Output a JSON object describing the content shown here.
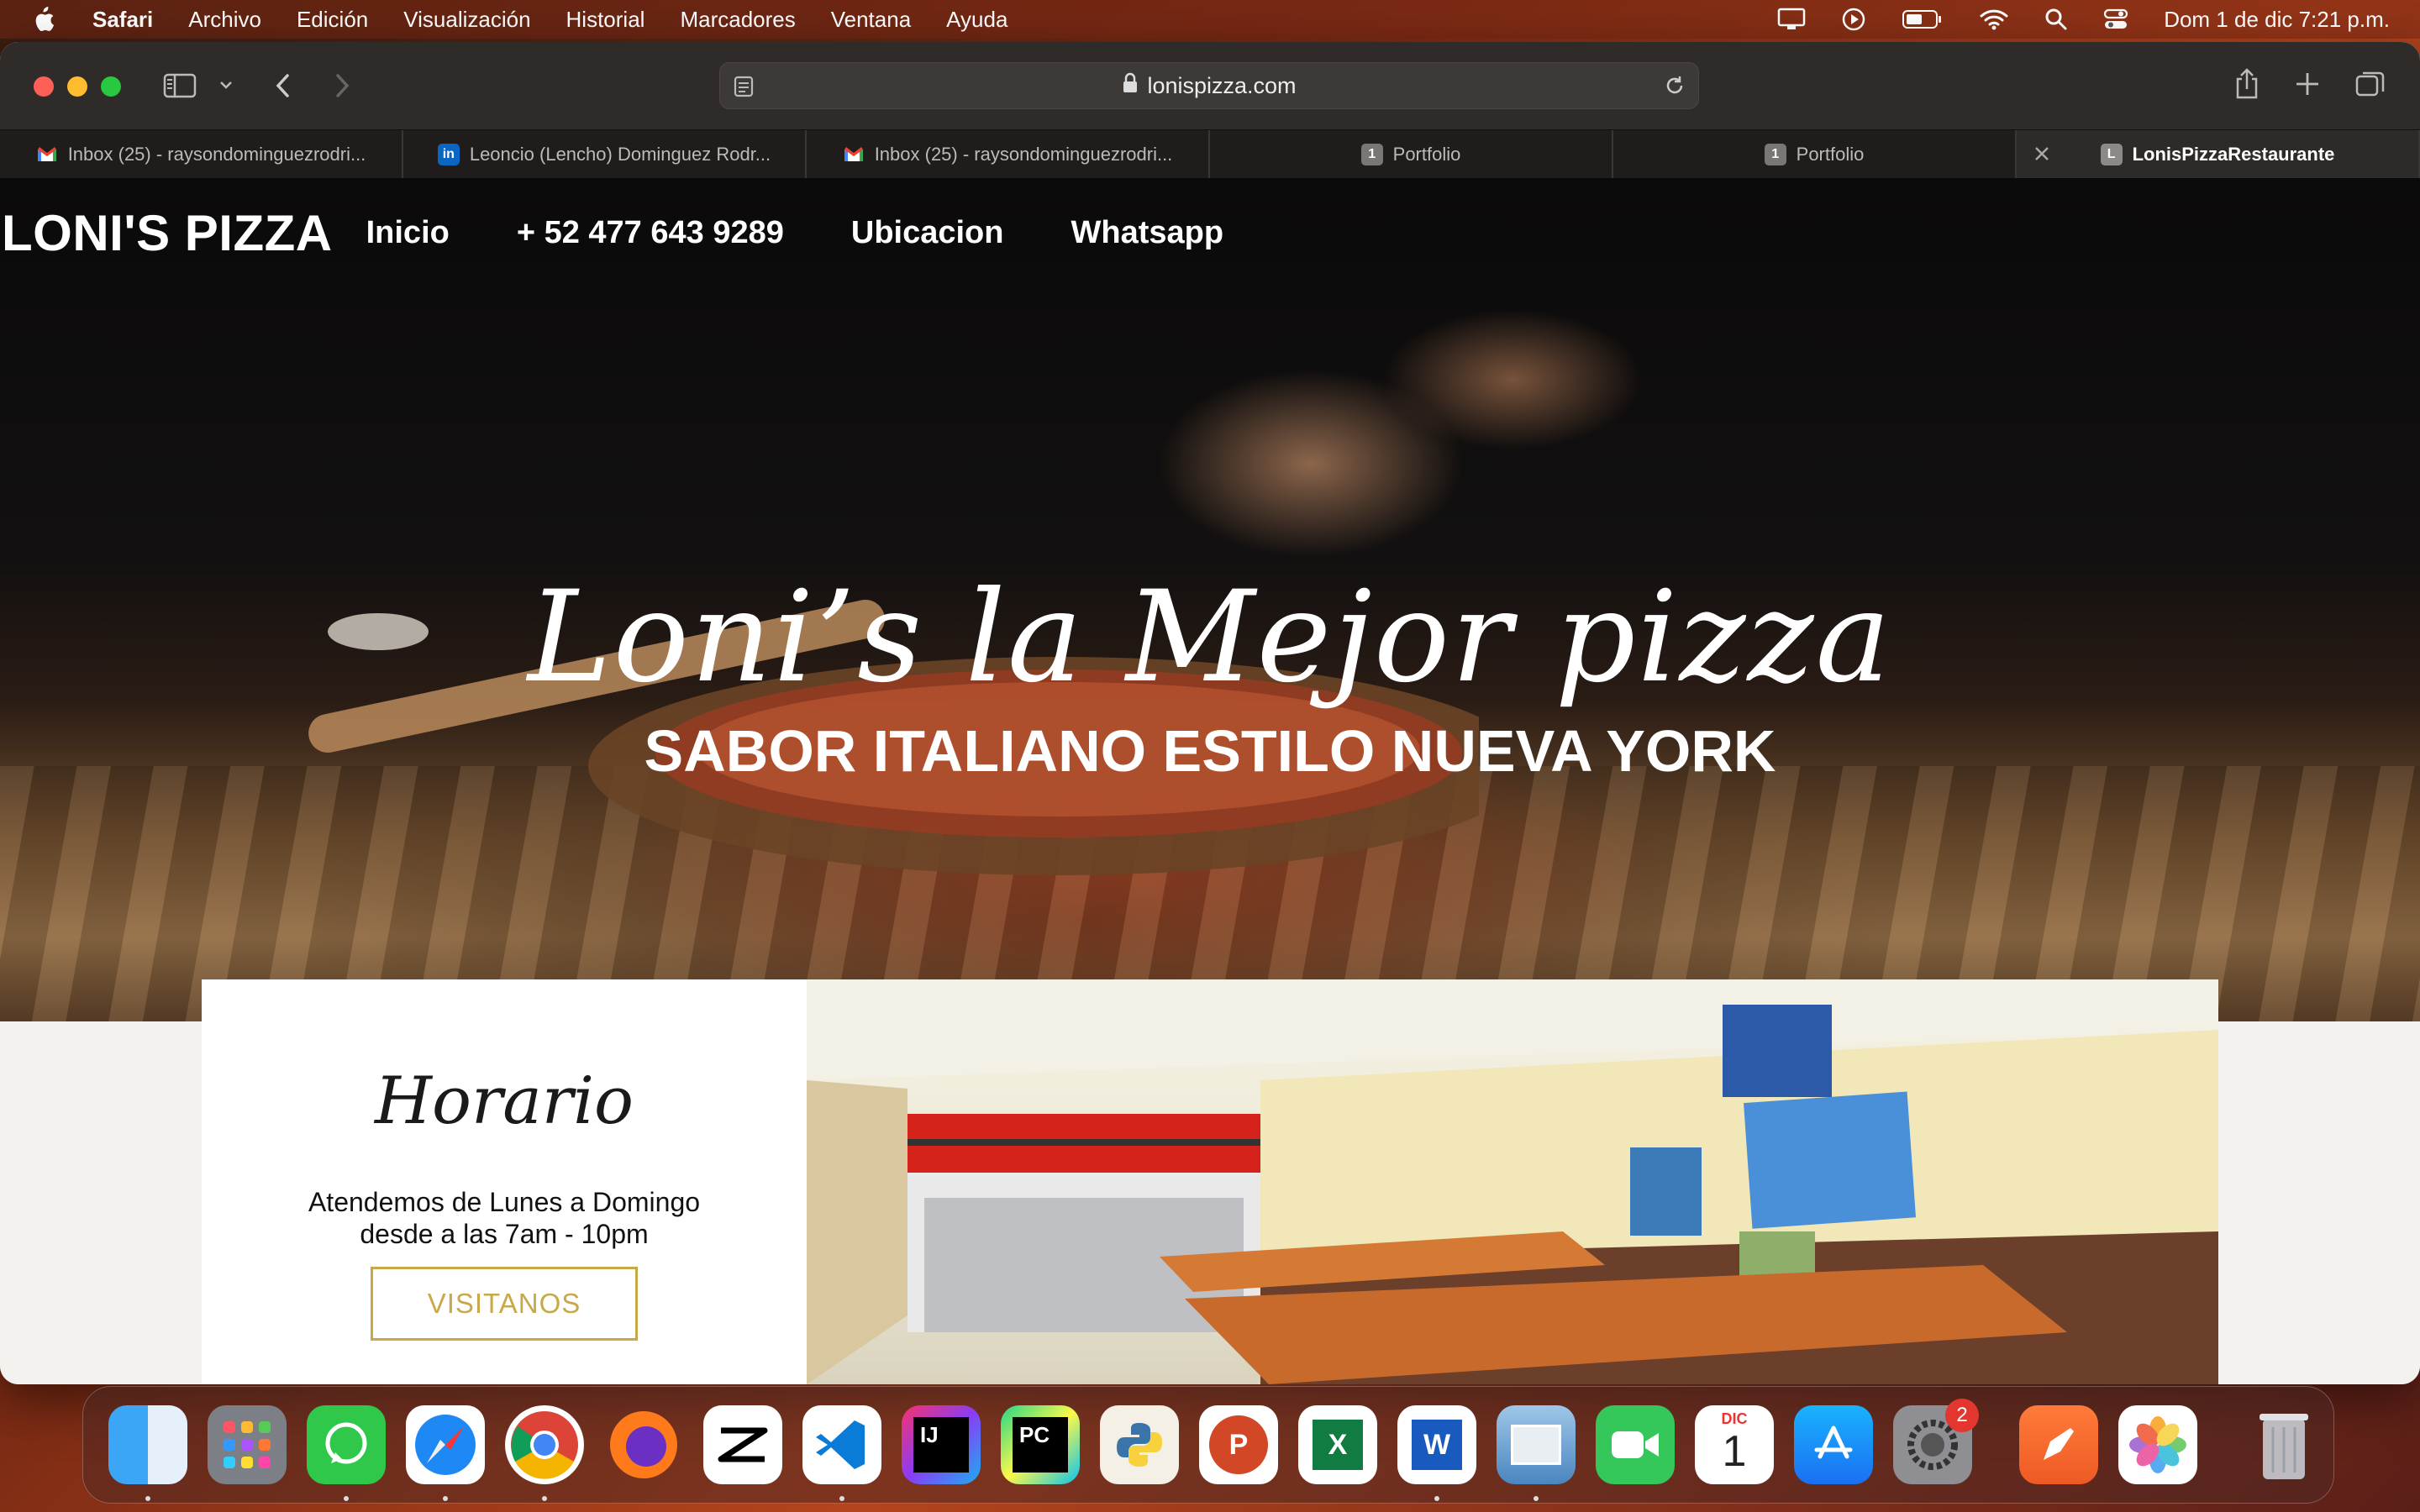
{
  "menubar": {
    "app_name": "Safari",
    "items": [
      "Archivo",
      "Edición",
      "Visualización",
      "Historial",
      "Marcadores",
      "Ventana",
      "Ayuda"
    ],
    "clock": "Dom 1 de dic  7:21 p.m."
  },
  "browser": {
    "url": "lonispizza.com",
    "tabs": [
      {
        "label": "Inbox (25) - raysondominguezrodri...",
        "icon": "gmail-icon"
      },
      {
        "label": "Leoncio (Lencho) Dominguez Rodr...",
        "icon": "linkedin-icon"
      },
      {
        "label": "Inbox (25) - raysondominguezrodri...",
        "icon": "gmail-icon"
      },
      {
        "label": "Portfolio",
        "icon": "portfolio-icon",
        "fav_text": "1"
      },
      {
        "label": "Portfolio",
        "icon": "portfolio-icon",
        "fav_text": "1"
      },
      {
        "label": "LonisPizzaRestaurante",
        "icon": "page-icon",
        "fav_text": "L",
        "active": true
      }
    ]
  },
  "site": {
    "brand": "LONI'S PIZZA",
    "nav": [
      "Inicio",
      "+ 52 477 643 9289",
      "Ubicacion",
      "Whatsapp"
    ],
    "hero_title": "Loni’s la Mejor pizza",
    "hero_subtitle": "SABOR ITALIANO ESTILO NUEVA YORK",
    "schedule": {
      "title": "Horario",
      "line1": "Atendemos de Lunes a Domingo",
      "line2": "desde a las 7am - 10pm",
      "button": "VISITANOS"
    },
    "accent_color": "#c9a84a"
  },
  "dock": {
    "apps": [
      "Finder",
      "Launchpad",
      "WhatsApp",
      "Safari",
      "Chrome",
      "Firefox",
      "CapCut",
      "VS Code",
      "IntelliJ IDEA",
      "PyCharm",
      "Python Launcher",
      "PowerPoint",
      "Excel",
      "Word",
      "Preview",
      "FaceTime",
      "Calendar",
      "App Store",
      "System Settings",
      "Pages Pen",
      "Photos",
      "Trash"
    ],
    "calendar_month": "DIC",
    "calendar_day": "1",
    "settings_badge": "2",
    "idea_text": "IJ",
    "pycharm_text": "PC",
    "ppt_text": "P",
    "excel_text": "X",
    "word_text": "W"
  }
}
